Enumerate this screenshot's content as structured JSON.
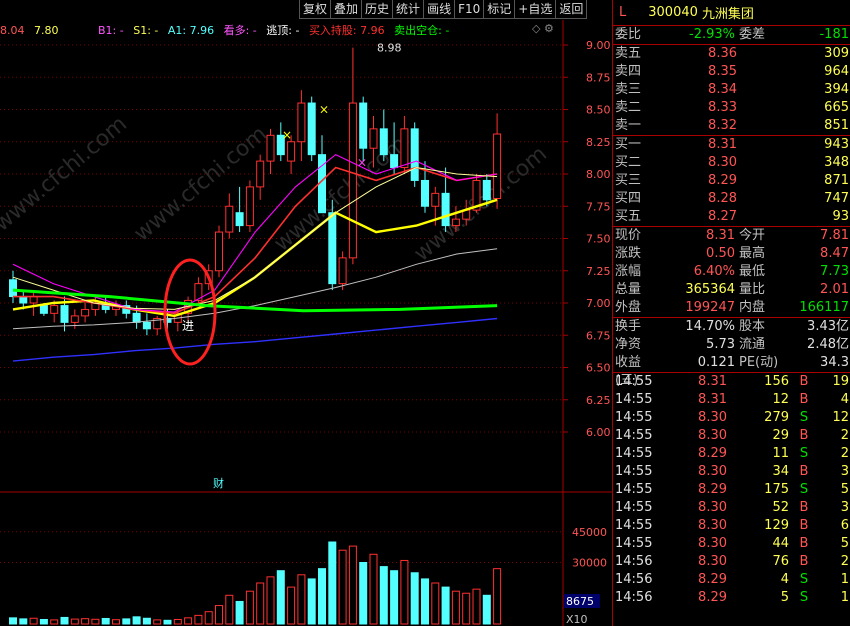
{
  "toolbar": [
    "复权",
    "叠加",
    "历史",
    "统计",
    "画线",
    "F10",
    "标记",
    "+自选",
    "返回"
  ],
  "indicators": {
    "i1": "8.04",
    "i2": "7.80",
    "b1": "B1: -",
    "s1": "S1: -",
    "a1": "A1: 7.96",
    "look_long": "看多: -",
    "escape_top": "逃顶: -",
    "buy_hold": "买入持股: 7.96",
    "sell_empty": "卖出空仓: -"
  },
  "chart": {
    "price_axis": [
      "9.00",
      "8.75",
      "8.50",
      "8.25",
      "8.00",
      "7.75",
      "7.50",
      "7.25",
      "7.00",
      "6.75",
      "6.50",
      "6.25",
      "6.00"
    ],
    "high_label": "8.98",
    "enter_label": "进",
    "finance_label": "财",
    "volume_axis": [
      "45000",
      "30000"
    ],
    "volume_value": "8675",
    "volume_mult": "X10",
    "watermark": "www.cfchi.com",
    "colors": {
      "up": "#ff3030",
      "down": "#54ffff",
      "ma5": "#ffffff",
      "ma10": "#ffff00",
      "ma20": "#ff00ff",
      "ma30": "#00ff00",
      "ma60": "#c0c0c0",
      "ma120": "#3030ff"
    }
  },
  "stock": {
    "mark": "L",
    "code": "300040",
    "name": "九洲集团"
  },
  "committee": {
    "ratio_label": "委比",
    "ratio": "-2.93%",
    "diff_label": "委差",
    "diff": "-181"
  },
  "asks": [
    {
      "label": "卖五",
      "price": "8.36",
      "vol": "309"
    },
    {
      "label": "卖四",
      "price": "8.35",
      "vol": "964"
    },
    {
      "label": "卖三",
      "price": "8.34",
      "vol": "394"
    },
    {
      "label": "卖二",
      "price": "8.33",
      "vol": "665"
    },
    {
      "label": "卖一",
      "price": "8.32",
      "vol": "851"
    }
  ],
  "bids": [
    {
      "label": "买一",
      "price": "8.31",
      "vol": "943"
    },
    {
      "label": "买二",
      "price": "8.30",
      "vol": "348"
    },
    {
      "label": "买三",
      "price": "8.29",
      "vol": "871"
    },
    {
      "label": "买四",
      "price": "8.28",
      "vol": "747"
    },
    {
      "label": "买五",
      "price": "8.27",
      "vol": "93"
    }
  ],
  "quote": [
    {
      "k1": "现价",
      "v1": "8.31",
      "c1": "red",
      "k2": "今开",
      "v2": "7.81",
      "c2": "red"
    },
    {
      "k1": "涨跌",
      "v1": "0.50",
      "c1": "red",
      "k2": "最高",
      "v2": "8.47",
      "c2": "red"
    },
    {
      "k1": "涨幅",
      "v1": "6.40%",
      "c1": "red",
      "k2": "最低",
      "v2": "7.73",
      "c2": "green"
    },
    {
      "k1": "总量",
      "v1": "365364",
      "c1": "yel",
      "k2": "量比",
      "v2": "2.01",
      "c2": "red"
    },
    {
      "k1": "外盘",
      "v1": "199247",
      "c1": "red",
      "k2": "内盘",
      "v2": "166117",
      "c2": "green"
    }
  ],
  "quote2": [
    {
      "k1": "换手",
      "v1": "14.70%",
      "k2": "股本",
      "v2": "3.43亿"
    },
    {
      "k1": "净资",
      "v1": "5.73",
      "k2": "流通",
      "v2": "2.48亿"
    },
    {
      "k1": "收益(三)",
      "v1": "0.121",
      "k2": "PE(动)",
      "v2": "34.3"
    }
  ],
  "ticks": [
    {
      "t": "14:55",
      "p": "8.31",
      "v": "156",
      "f": "B",
      "n": "19"
    },
    {
      "t": "14:55",
      "p": "8.31",
      "v": "12",
      "f": "B",
      "n": "4"
    },
    {
      "t": "14:55",
      "p": "8.30",
      "v": "279",
      "f": "S",
      "n": "12"
    },
    {
      "t": "14:55",
      "p": "8.30",
      "v": "29",
      "f": "B",
      "n": "2"
    },
    {
      "t": "14:55",
      "p": "8.29",
      "v": "11",
      "f": "S",
      "n": "2"
    },
    {
      "t": "14:55",
      "p": "8.30",
      "v": "34",
      "f": "B",
      "n": "3"
    },
    {
      "t": "14:55",
      "p": "8.29",
      "v": "175",
      "f": "S",
      "n": "5"
    },
    {
      "t": "14:55",
      "p": "8.30",
      "v": "52",
      "f": "B",
      "n": "3"
    },
    {
      "t": "14:55",
      "p": "8.30",
      "v": "129",
      "f": "B",
      "n": "6"
    },
    {
      "t": "14:55",
      "p": "8.30",
      "v": "44",
      "f": "B",
      "n": "5"
    },
    {
      "t": "14:56",
      "p": "8.30",
      "v": "76",
      "f": "B",
      "n": "2"
    },
    {
      "t": "14:56",
      "p": "8.29",
      "v": "4",
      "f": "S",
      "n": "1"
    },
    {
      "t": "14:56",
      "p": "8.29",
      "v": "5",
      "f": "S",
      "n": "1"
    }
  ]
}
